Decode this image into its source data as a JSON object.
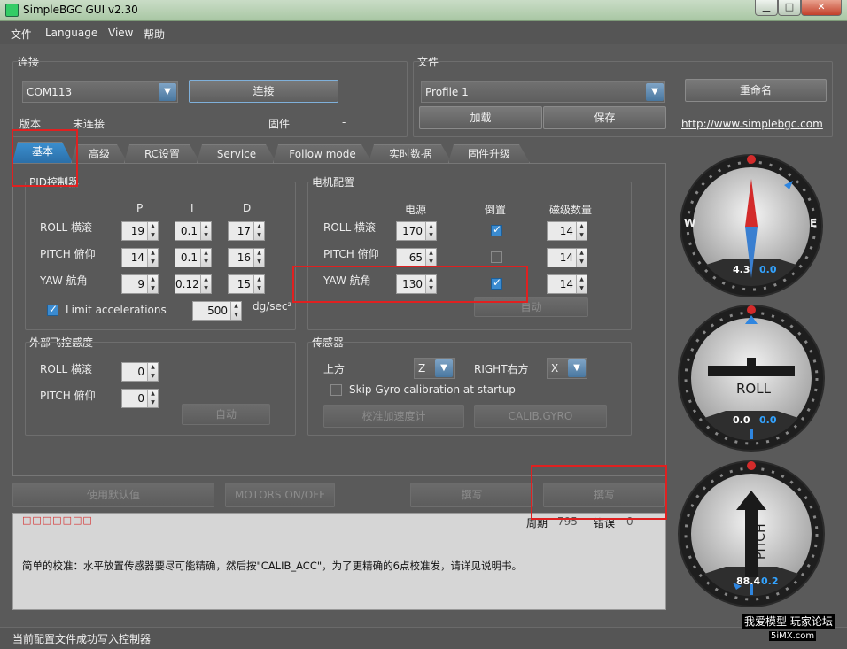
{
  "window": {
    "title": "SimpleBGC GUI v2.30"
  },
  "menu": [
    "文件",
    "Language",
    "View",
    "帮助"
  ],
  "connection": {
    "group_label": "连接",
    "port_value": "COM113",
    "connect_button": "连接",
    "version_label": "版本",
    "version_value": "未连接",
    "firmware_label": "固件",
    "firmware_value": "-"
  },
  "file": {
    "group_label": "文件",
    "profile_value": "Profile 1",
    "rename_button": "重命名",
    "load_button": "加载",
    "save_button": "保存",
    "website_link": "http://www.simplebgc.com"
  },
  "tabs": [
    "基本",
    "高级",
    "RC设置",
    "Service",
    "Follow mode",
    "实时数据",
    "固件升级"
  ],
  "pid": {
    "group_label": "PID控制器",
    "col_p": "P",
    "col_i": "I",
    "col_d": "D",
    "rows": [
      {
        "label": "ROLL 横滚",
        "p": "19",
        "i": "0.1",
        "d": "17"
      },
      {
        "label": "PITCH 俯仰",
        "p": "14",
        "i": "0.1",
        "d": "16"
      },
      {
        "label": "YAW 航角",
        "p": "9",
        "i": "0.12",
        "d": "15"
      }
    ],
    "limit_label": "Limit accelerations",
    "limit_checked": true,
    "limit_value": "500",
    "limit_unit": "dg/sec²"
  },
  "motor": {
    "group_label": "电机配置",
    "col_power": "电源",
    "col_invert": "倒置",
    "col_poles": "磁级数量",
    "rows": [
      {
        "label": "ROLL 横滚",
        "power": "170",
        "invert": true,
        "poles": "14"
      },
      {
        "label": "PITCH 俯仰",
        "power": "65",
        "invert": false,
        "poles": "14"
      },
      {
        "label": "YAW 航角",
        "power": "130",
        "invert": true,
        "poles": "14"
      }
    ],
    "auto_button": "自动"
  },
  "external": {
    "group_label": "外部飞控感度",
    "rows": [
      {
        "label": "ROLL 横滚",
        "value": "0"
      },
      {
        "label": "PITCH 俯仰",
        "value": "0"
      }
    ],
    "auto_button": "自动"
  },
  "sensor": {
    "group_label": "传感器",
    "top_label": "上方",
    "top_value": "Z",
    "right_label": "RIGHT右方",
    "right_value": "X",
    "skip_gyro_label": "Skip Gyro calibration at startup",
    "calib_acc_button": "校准加速度计",
    "calib_gyro_button": "CALIB.GYRO"
  },
  "bottom_buttons": {
    "defaults": "使用默认值",
    "motors": "MOTORS ON/OFF",
    "read": "撰写",
    "write": "撰写"
  },
  "log": {
    "error_marks": "□□□□□□□",
    "period_label": "周期",
    "period_value": "795",
    "errors_label": "错误",
    "errors_value": "0",
    "message": "简单的校准：水平放置传感器要尽可能精确，然后按\"CALIB_ACC\"，为了更精确的6点校准发，请详见说明书。"
  },
  "status": "当前配置文件成功写入控制器",
  "gauges": {
    "yaw": {
      "left": "4.3",
      "right": "0.0",
      "west": "W",
      "east": "E"
    },
    "roll": {
      "label": "ROLL",
      "left": "0.0",
      "right": "0.0"
    },
    "pitch": {
      "label": "PITCH",
      "left": "88.4",
      "right": "0.2"
    }
  },
  "watermark": {
    "line1": "我爱模型 玩家论坛",
    "line2": "5iMX.com"
  },
  "colors": {
    "accent": "#2f7fc4",
    "highlight_red": "#e02020",
    "value_blue": "#33a3ff"
  }
}
